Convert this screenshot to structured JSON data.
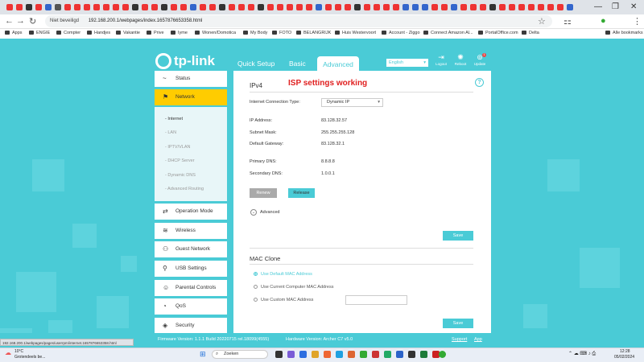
{
  "browser": {
    "window_minimize": "—",
    "window_restore": "❐",
    "window_close": "✕",
    "secure_label": "Niet beveiligd",
    "url": "192.168.200.1/webpages/index.1657876653358.html",
    "bookmarks": [
      "Apps",
      "ENGIE",
      "Compter",
      "Handjes",
      "Vakantie",
      "Prive",
      "Iyme",
      "Wonen/Domotica",
      "My Body",
      "FOTO",
      "BELANGRIJK",
      "Huis Westervoort",
      "Account - Ziggo",
      "Connect Amazon Al...",
      "PortalOffice.com",
      "Delta",
      "Alle bookmarks"
    ]
  },
  "router": {
    "brand": "tp-link",
    "tabs": {
      "quick_setup": "Quick Setup",
      "basic": "Basic",
      "advanced": "Advanced"
    },
    "language": "English",
    "top_icons": {
      "logout": "Logout",
      "reboot": "Reboot",
      "update": "Update",
      "update_badge": "1"
    },
    "sidebar": [
      {
        "label": "Status",
        "icon": "~"
      },
      {
        "label": "Network",
        "icon": "⚑"
      },
      {
        "label": "Operation Mode",
        "icon": "⇄"
      },
      {
        "label": "Wireless",
        "icon": "≋"
      },
      {
        "label": "Guest Network",
        "icon": "⚇"
      },
      {
        "label": "USB Settings",
        "icon": "⚲"
      },
      {
        "label": "Parental Controls",
        "icon": "☺"
      },
      {
        "label": "QoS",
        "icon": "◔"
      },
      {
        "label": "Security",
        "icon": "◈"
      }
    ],
    "submenu": [
      "- Internet",
      "- LAN",
      "- IPTV/VLAN",
      "- DHCP Server",
      "- Dynamic DNS",
      "- Advanced Routing"
    ],
    "ipv4": {
      "title": "IPv4",
      "annotation": "ISP settings working",
      "connection_type_label": "Internet Connection Type:",
      "connection_type": "Dynamic IP",
      "ip_label": "IP Address:",
      "ip": "83.128.32.57",
      "mask_label": "Subnet Mask:",
      "mask": "255.255.255.128",
      "gateway_label": "Default Gateway:",
      "gateway": "83.128.32.1",
      "pdns_label": "Primary DNS:",
      "pdns": "8.8.8.8",
      "sdns_label": "Secondary DNS:",
      "sdns": "1.0.0.1",
      "renew": "Renew",
      "release": "Release",
      "advanced": "Advanced",
      "save": "Save"
    },
    "mac_clone": {
      "title": "MAC Clone",
      "options": [
        "Use Default MAC Address",
        "Use Current Computer MAC Address",
        "Use Custom MAC Address"
      ],
      "save": "Save"
    },
    "footer": {
      "firmware": "Firmware Version: 1.1.1 Build 20220715 rel.18099(4555)",
      "hardware": "Hardware Version: Archer C7 v5.0",
      "support": "Support",
      "app": "App"
    },
    "status_url": "192.168.200.1/webpages/pages/userrpm/internet.1657876653358.html"
  },
  "taskbar": {
    "weather_temp": "10°C",
    "weather_text": "Grotendeels be...",
    "search": "Zoeken",
    "time": "12:28",
    "date": "05/02/2024"
  },
  "colors": {
    "teal": "#4acbd6",
    "yellow": "#ffcc00",
    "annotation_red": "#e02020"
  }
}
